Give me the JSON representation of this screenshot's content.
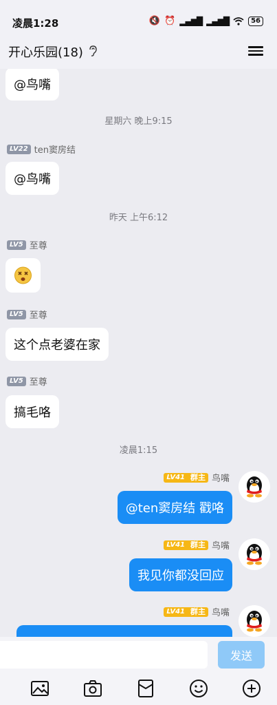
{
  "status_bar": {
    "time": "凌晨1:28",
    "battery": "56"
  },
  "header": {
    "title": "开心乐园(18)"
  },
  "messages": {
    "m0_text": "@鸟嘴",
    "ts1": "星期六 晚上9:15",
    "m1_level": "LV22",
    "m1_sender": "ten窦房结",
    "m1_text": "@鸟嘴",
    "ts2": "昨天 上午6:12",
    "m2_level": "LV5",
    "m2_sender": "至尊",
    "m3_level": "LV5",
    "m3_sender": "至尊",
    "m3_text": "这个点老婆在家",
    "m4_level": "LV5",
    "m4_sender": "至尊",
    "m4_text": "搞毛咯",
    "ts3": "凌晨1:15",
    "o1_level": "LV41",
    "o1_role": "群主",
    "o1_sender": "鸟嘴",
    "o1_text": "@ten窦房结 戳咯",
    "o2_level": "LV41",
    "o2_role": "群主",
    "o2_sender": "鸟嘴",
    "o2_text": "我见你都没回应",
    "o3_level": "LV41",
    "o3_role": "群主",
    "o3_sender": "鸟嘴"
  },
  "input": {
    "value": "",
    "send_label": "发送"
  },
  "colors": {
    "accent": "#1a8df5",
    "owner_badge": "#f6b715",
    "send_disabled": "#8fc9f8"
  },
  "icons": [
    "image-icon",
    "camera-icon",
    "red-packet-icon",
    "emoji-icon",
    "plus-icon"
  ]
}
